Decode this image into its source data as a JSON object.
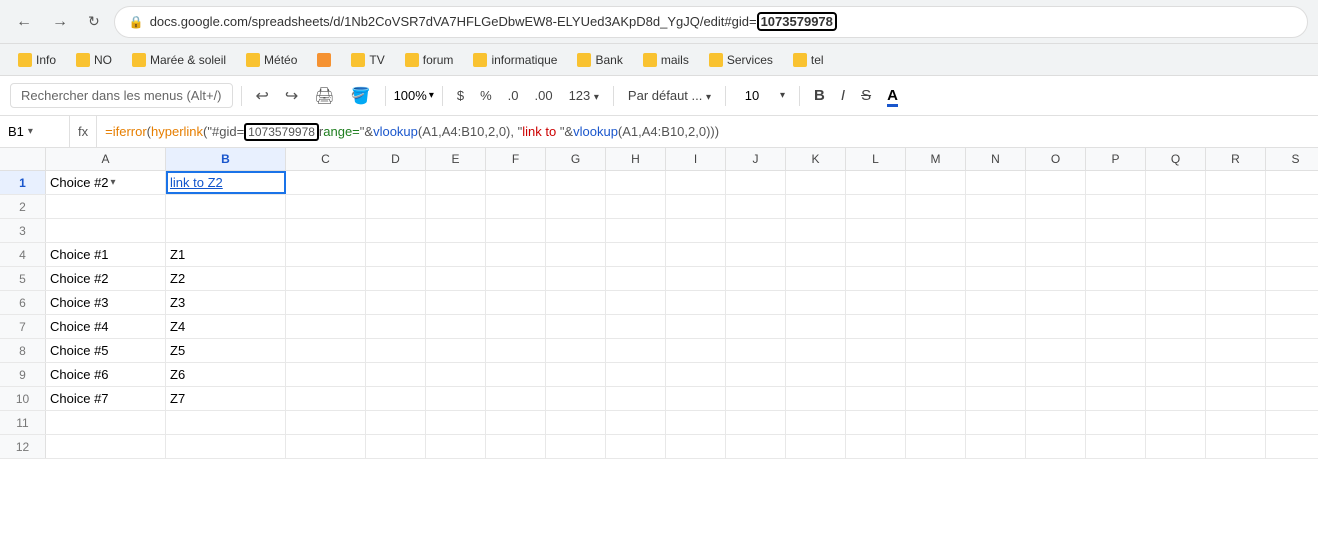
{
  "browser": {
    "url_prefix": "docs.google.com/spreadsheets/d/1Nb2CoVSR7dVA7HFLGeDbwEW8-ELYUed3AKpD8d_YgJQ/edit#gid=",
    "url_highlight": "1073579978",
    "lock_icon": "🔒"
  },
  "bookmarks": [
    {
      "label": "Info",
      "color": "bk-yellow"
    },
    {
      "label": "NO",
      "color": "bk-yellow"
    },
    {
      "label": "Marée & soleil",
      "color": "bk-yellow"
    },
    {
      "label": "Météo",
      "color": "bk-yellow"
    },
    {
      "label": "",
      "color": "bk-orange",
      "icon": "bookmark"
    },
    {
      "label": "TV",
      "color": "bk-yellow"
    },
    {
      "label": "forum",
      "color": "bk-yellow"
    },
    {
      "label": "informatique",
      "color": "bk-yellow"
    },
    {
      "label": "Bank",
      "color": "bk-yellow"
    },
    {
      "label": "mails",
      "color": "bk-yellow"
    },
    {
      "label": "Services",
      "color": "bk-yellow"
    },
    {
      "label": "tel",
      "color": "bk-yellow"
    }
  ],
  "toolbar": {
    "search_placeholder": "Rechercher dans les menus (Alt+/)",
    "zoom": "100%",
    "currency": "$",
    "percent": "%",
    "decimal_less": ".0",
    "decimal_more": ".00",
    "format_123": "123",
    "font_family": "Par défaut ...",
    "font_size": "10",
    "bold": "B",
    "italic": "I",
    "strikethrough": "S",
    "font_color": "A"
  },
  "formula_bar": {
    "cell_ref": "B1",
    "fx": "fx",
    "formula_parts": {
      "prefix": "=iferror(hyperlink(\"#gid=",
      "highlight": "1073579978",
      "middle": "r",
      "suffix1": "ange=\"&vlookup(A1,A4:B10,2,0),  \"link to \"&vlookup(A1,A4:B10,2,0)))"
    }
  },
  "columns": [
    "A",
    "B",
    "C",
    "D",
    "E",
    "F",
    "G",
    "H",
    "I",
    "J",
    "K",
    "L",
    "M",
    "N",
    "O",
    "P",
    "Q",
    "R",
    "S"
  ],
  "active_col": "B",
  "active_row": 1,
  "rows": [
    {
      "num": 1,
      "cells": {
        "A": {
          "value": "Choice #2",
          "has_dropdown": true
        },
        "B": {
          "value": "link to Z2",
          "is_link": true,
          "selected": true
        }
      }
    },
    {
      "num": 2,
      "cells": {}
    },
    {
      "num": 3,
      "cells": {}
    },
    {
      "num": 4,
      "cells": {
        "A": {
          "value": "Choice #1"
        },
        "B": {
          "value": "Z1"
        }
      }
    },
    {
      "num": 5,
      "cells": {
        "A": {
          "value": "Choice #2"
        },
        "B": {
          "value": "Z2"
        }
      }
    },
    {
      "num": 6,
      "cells": {
        "A": {
          "value": "Choice #3"
        },
        "B": {
          "value": "Z3"
        }
      }
    },
    {
      "num": 7,
      "cells": {
        "A": {
          "value": "Choice #4"
        },
        "B": {
          "value": "Z4"
        }
      }
    },
    {
      "num": 8,
      "cells": {
        "A": {
          "value": "Choice #5"
        },
        "B": {
          "value": "Z5"
        }
      }
    },
    {
      "num": 9,
      "cells": {
        "A": {
          "value": "Choice #6"
        },
        "B": {
          "value": "Z6"
        }
      }
    },
    {
      "num": 10,
      "cells": {
        "A": {
          "value": "Choice #7"
        },
        "B": {
          "value": "Z7"
        }
      }
    },
    {
      "num": 11,
      "cells": {}
    },
    {
      "num": 12,
      "cells": {}
    }
  ]
}
